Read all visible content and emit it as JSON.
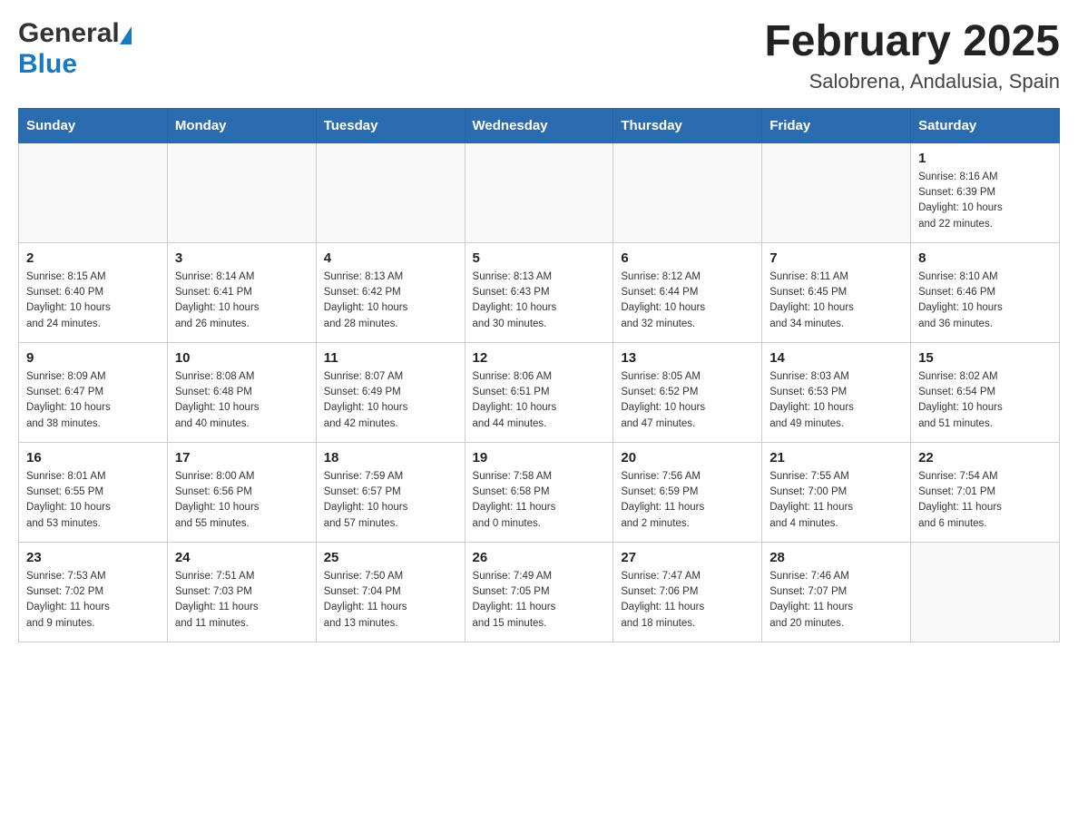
{
  "header": {
    "logo_general": "General",
    "logo_blue": "Blue",
    "month_title": "February 2025",
    "location": "Salobrena, Andalusia, Spain"
  },
  "days_of_week": [
    "Sunday",
    "Monday",
    "Tuesday",
    "Wednesday",
    "Thursday",
    "Friday",
    "Saturday"
  ],
  "weeks": [
    [
      {
        "day": "",
        "info": ""
      },
      {
        "day": "",
        "info": ""
      },
      {
        "day": "",
        "info": ""
      },
      {
        "day": "",
        "info": ""
      },
      {
        "day": "",
        "info": ""
      },
      {
        "day": "",
        "info": ""
      },
      {
        "day": "1",
        "info": "Sunrise: 8:16 AM\nSunset: 6:39 PM\nDaylight: 10 hours\nand 22 minutes."
      }
    ],
    [
      {
        "day": "2",
        "info": "Sunrise: 8:15 AM\nSunset: 6:40 PM\nDaylight: 10 hours\nand 24 minutes."
      },
      {
        "day": "3",
        "info": "Sunrise: 8:14 AM\nSunset: 6:41 PM\nDaylight: 10 hours\nand 26 minutes."
      },
      {
        "day": "4",
        "info": "Sunrise: 8:13 AM\nSunset: 6:42 PM\nDaylight: 10 hours\nand 28 minutes."
      },
      {
        "day": "5",
        "info": "Sunrise: 8:13 AM\nSunset: 6:43 PM\nDaylight: 10 hours\nand 30 minutes."
      },
      {
        "day": "6",
        "info": "Sunrise: 8:12 AM\nSunset: 6:44 PM\nDaylight: 10 hours\nand 32 minutes."
      },
      {
        "day": "7",
        "info": "Sunrise: 8:11 AM\nSunset: 6:45 PM\nDaylight: 10 hours\nand 34 minutes."
      },
      {
        "day": "8",
        "info": "Sunrise: 8:10 AM\nSunset: 6:46 PM\nDaylight: 10 hours\nand 36 minutes."
      }
    ],
    [
      {
        "day": "9",
        "info": "Sunrise: 8:09 AM\nSunset: 6:47 PM\nDaylight: 10 hours\nand 38 minutes."
      },
      {
        "day": "10",
        "info": "Sunrise: 8:08 AM\nSunset: 6:48 PM\nDaylight: 10 hours\nand 40 minutes."
      },
      {
        "day": "11",
        "info": "Sunrise: 8:07 AM\nSunset: 6:49 PM\nDaylight: 10 hours\nand 42 minutes."
      },
      {
        "day": "12",
        "info": "Sunrise: 8:06 AM\nSunset: 6:51 PM\nDaylight: 10 hours\nand 44 minutes."
      },
      {
        "day": "13",
        "info": "Sunrise: 8:05 AM\nSunset: 6:52 PM\nDaylight: 10 hours\nand 47 minutes."
      },
      {
        "day": "14",
        "info": "Sunrise: 8:03 AM\nSunset: 6:53 PM\nDaylight: 10 hours\nand 49 minutes."
      },
      {
        "day": "15",
        "info": "Sunrise: 8:02 AM\nSunset: 6:54 PM\nDaylight: 10 hours\nand 51 minutes."
      }
    ],
    [
      {
        "day": "16",
        "info": "Sunrise: 8:01 AM\nSunset: 6:55 PM\nDaylight: 10 hours\nand 53 minutes."
      },
      {
        "day": "17",
        "info": "Sunrise: 8:00 AM\nSunset: 6:56 PM\nDaylight: 10 hours\nand 55 minutes."
      },
      {
        "day": "18",
        "info": "Sunrise: 7:59 AM\nSunset: 6:57 PM\nDaylight: 10 hours\nand 57 minutes."
      },
      {
        "day": "19",
        "info": "Sunrise: 7:58 AM\nSunset: 6:58 PM\nDaylight: 11 hours\nand 0 minutes."
      },
      {
        "day": "20",
        "info": "Sunrise: 7:56 AM\nSunset: 6:59 PM\nDaylight: 11 hours\nand 2 minutes."
      },
      {
        "day": "21",
        "info": "Sunrise: 7:55 AM\nSunset: 7:00 PM\nDaylight: 11 hours\nand 4 minutes."
      },
      {
        "day": "22",
        "info": "Sunrise: 7:54 AM\nSunset: 7:01 PM\nDaylight: 11 hours\nand 6 minutes."
      }
    ],
    [
      {
        "day": "23",
        "info": "Sunrise: 7:53 AM\nSunset: 7:02 PM\nDaylight: 11 hours\nand 9 minutes."
      },
      {
        "day": "24",
        "info": "Sunrise: 7:51 AM\nSunset: 7:03 PM\nDaylight: 11 hours\nand 11 minutes."
      },
      {
        "day": "25",
        "info": "Sunrise: 7:50 AM\nSunset: 7:04 PM\nDaylight: 11 hours\nand 13 minutes."
      },
      {
        "day": "26",
        "info": "Sunrise: 7:49 AM\nSunset: 7:05 PM\nDaylight: 11 hours\nand 15 minutes."
      },
      {
        "day": "27",
        "info": "Sunrise: 7:47 AM\nSunset: 7:06 PM\nDaylight: 11 hours\nand 18 minutes."
      },
      {
        "day": "28",
        "info": "Sunrise: 7:46 AM\nSunset: 7:07 PM\nDaylight: 11 hours\nand 20 minutes."
      },
      {
        "day": "",
        "info": ""
      }
    ]
  ]
}
